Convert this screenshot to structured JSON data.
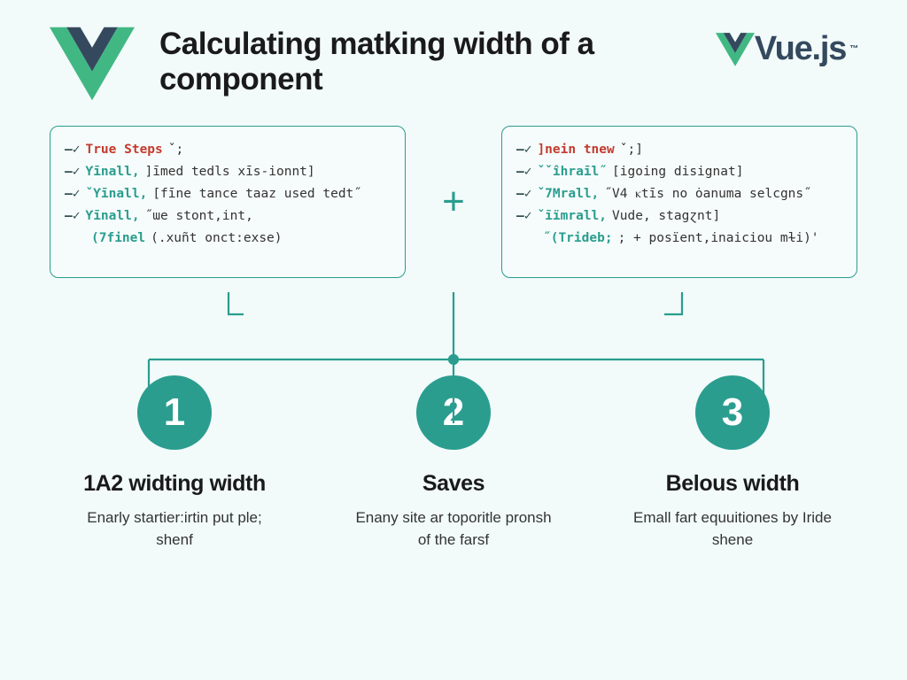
{
  "header": {
    "title": "Calculating matking width of a component",
    "brand": "Vue.js",
    "brand_tm": "™"
  },
  "code_left": {
    "l1": {
      "tick": "—✓",
      "kw": "True Steps",
      "rest": " ˇ;"
    },
    "l2": {
      "tick": "—✓",
      "kw": "Ƴīnall,",
      "rest": "]īmed tedls xīs-ionnt]"
    },
    "l3": {
      "tick": "—✓",
      "kw": "ˇƳīnall,",
      "rest": "[fīne tance taaz used tedt˝"
    },
    "l4": {
      "tick": "—✓",
      "kw": "Ƴīnall,",
      "rest": "˝ɯe stont,int,"
    },
    "l5": {
      "indent": "(7finel (.xuñt onct:exse)"
    }
  },
  "plus": "+",
  "code_right": {
    "l1": {
      "tick": "—✓",
      "kw": "]nein tnew",
      "rest": " ˇ;]"
    },
    "l2": {
      "tick": "—✓",
      "kw": "ˇˇîhraīl˝",
      "rest": "[igoing disignat]"
    },
    "l3": {
      "tick": "—✓",
      "kw": "ˇ7Mrall,",
      "rest": "˝V4 ⲕtīs no ȯanuma selcgns˝"
    },
    "l4": {
      "tick": "—✓",
      "kw": "ˇīïmrall,",
      "rest": "Vude, stagɀnt]"
    },
    "l5": {
      "indent": "˝(Trideb; ; + posïent,inaiciou mɫi)'"
    }
  },
  "steps": [
    {
      "num": "1",
      "title": "1A2 widting width",
      "desc": "Enarly startier:irtin put ple; shenf"
    },
    {
      "num": "2",
      "title": "Saves",
      "desc": "Enany site ar toporitle pronsh of the farsf"
    },
    {
      "num": "3",
      "title": "Belous width",
      "desc": "Emall fart equuitiones by Iride shene"
    }
  ],
  "colors": {
    "accent": "#2a9d8f",
    "vue_dark": "#34495e",
    "vue_green": "#41b883",
    "bg": "#f2fafa"
  }
}
